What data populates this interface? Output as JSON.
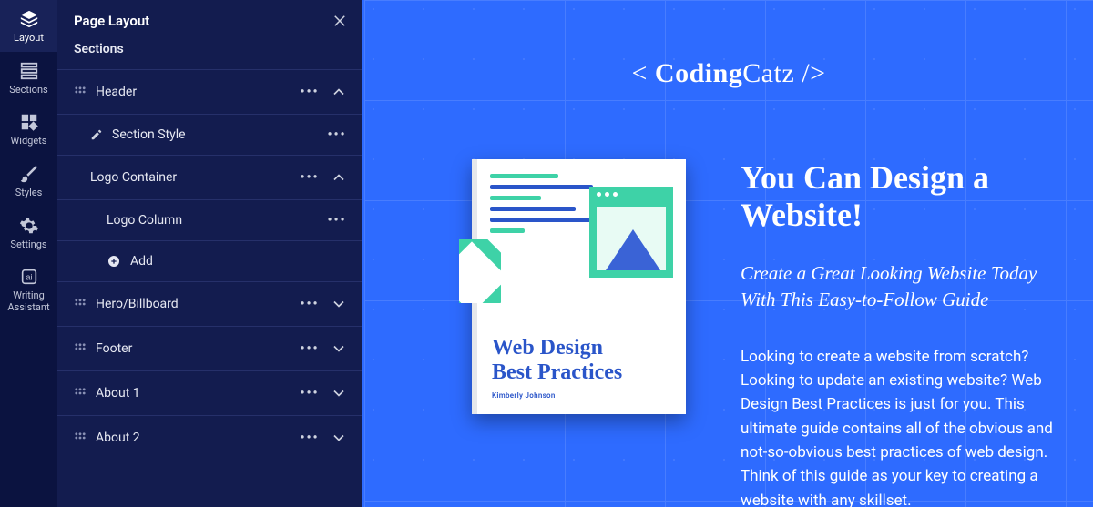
{
  "rail": [
    {
      "id": "layout",
      "label": "Layout",
      "active": true
    },
    {
      "id": "sections",
      "label": "Sections",
      "active": false
    },
    {
      "id": "widgets",
      "label": "Widgets",
      "active": false
    },
    {
      "id": "styles",
      "label": "Styles",
      "active": false
    },
    {
      "id": "settings",
      "label": "Settings",
      "active": false
    },
    {
      "id": "writing",
      "label": "Writing",
      "label2": "Assistant",
      "active": false
    }
  ],
  "panel": {
    "title": "Page Layout",
    "subtitle": "Sections",
    "header": {
      "label": "Header",
      "section_style": "Section Style",
      "logo_container": "Logo Container",
      "logo_column": "Logo Column",
      "add": "Add"
    },
    "rows": [
      {
        "id": "hero",
        "label": "Hero/Billboard"
      },
      {
        "id": "footer",
        "label": "Footer"
      },
      {
        "id": "about1",
        "label": "About 1"
      },
      {
        "id": "about2",
        "label": "About 2"
      }
    ]
  },
  "preview": {
    "brand_prefix": "< ",
    "brand_bold": "Coding",
    "brand_rest": "Catz />",
    "book": {
      "title_line1": "Web Design",
      "title_line2": "Best Practices",
      "author": "Kimberly Johnson"
    },
    "headline": "You Can Design a Website!",
    "subhead": "Create a Great Looking Website Today With This Easy-to-Follow Guide",
    "body": "Looking to create a website from scratch? Looking to update an existing website? Web Design Best Practices is just for you. This ultimate guide contains all of the obvious and not-so-obvious best practices of web design. Think of this guide as your key to creating a website with any skillset."
  }
}
